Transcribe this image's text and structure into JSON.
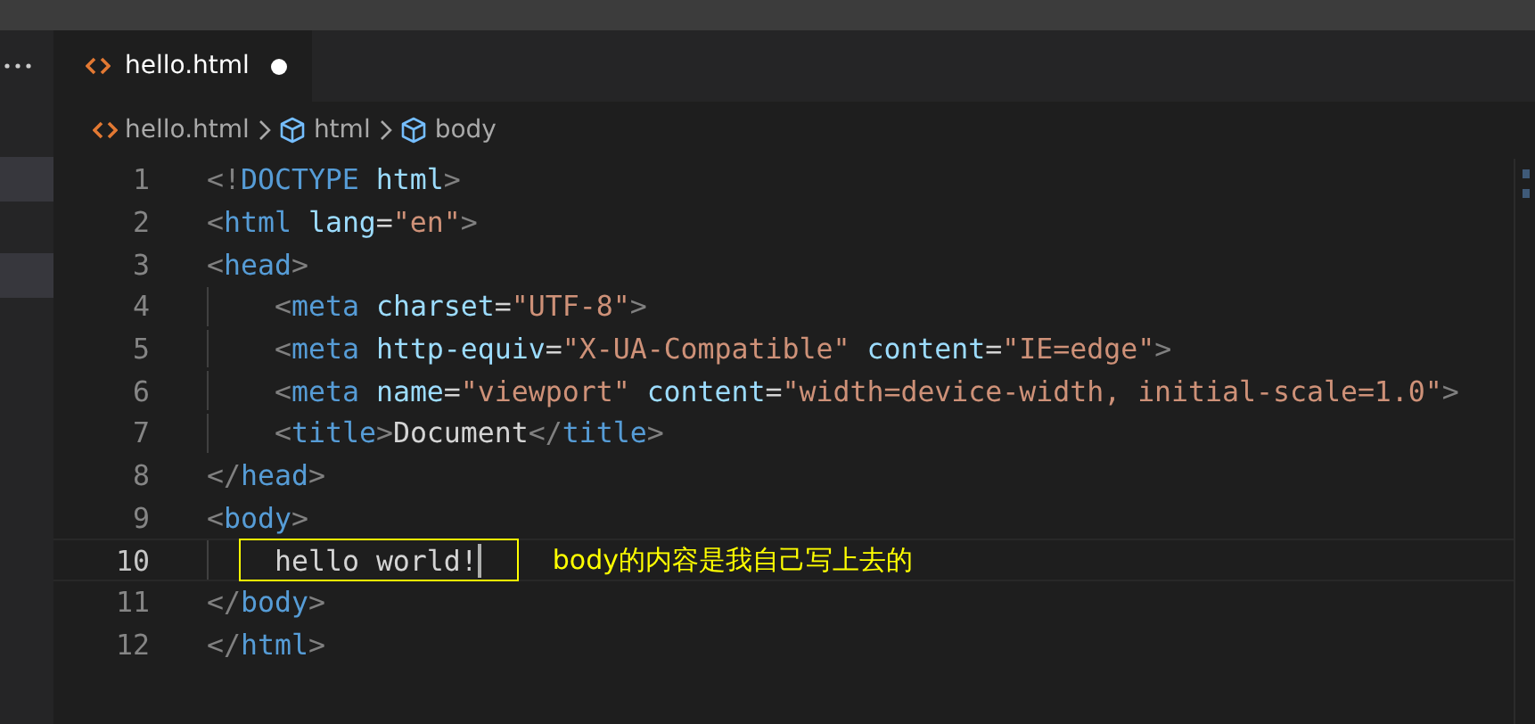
{
  "tab": {
    "label": "hello.html",
    "modified": true,
    "selected": true
  },
  "breadcrumb": [
    {
      "kind": "file",
      "label": "hello.html"
    },
    {
      "kind": "element",
      "label": "html"
    },
    {
      "kind": "element",
      "label": "body"
    }
  ],
  "code_lines": [
    {
      "number": "1",
      "active": false,
      "indented": false,
      "tokens": [
        {
          "kind": "punct",
          "text": "<!"
        },
        {
          "kind": "tag",
          "text": "DOCTYPE"
        },
        {
          "kind": "attr",
          "text": " html"
        },
        {
          "kind": "punct",
          "text": ">"
        }
      ]
    },
    {
      "number": "2",
      "active": false,
      "indented": false,
      "tokens": [
        {
          "kind": "punct",
          "text": "<"
        },
        {
          "kind": "tag",
          "text": "html"
        },
        {
          "kind": "attr",
          "text": " lang"
        },
        {
          "kind": "plain",
          "text": "="
        },
        {
          "kind": "value",
          "text": "\"en\""
        },
        {
          "kind": "punct",
          "text": ">"
        }
      ]
    },
    {
      "number": "3",
      "active": false,
      "indented": false,
      "tokens": [
        {
          "kind": "punct",
          "text": "<"
        },
        {
          "kind": "tag",
          "text": "head"
        },
        {
          "kind": "punct",
          "text": ">"
        }
      ]
    },
    {
      "number": "4",
      "active": false,
      "indented": true,
      "tokens": [
        {
          "kind": "punct",
          "text": "<"
        },
        {
          "kind": "tag",
          "text": "meta"
        },
        {
          "kind": "attr",
          "text": " charset"
        },
        {
          "kind": "plain",
          "text": "="
        },
        {
          "kind": "value",
          "text": "\"UTF-8\""
        },
        {
          "kind": "punct",
          "text": ">"
        }
      ]
    },
    {
      "number": "5",
      "active": false,
      "indented": true,
      "tokens": [
        {
          "kind": "punct",
          "text": "<"
        },
        {
          "kind": "tag",
          "text": "meta"
        },
        {
          "kind": "attr",
          "text": " http-equiv"
        },
        {
          "kind": "plain",
          "text": "="
        },
        {
          "kind": "value",
          "text": "\"X-UA-Compatible\""
        },
        {
          "kind": "attr",
          "text": " content"
        },
        {
          "kind": "plain",
          "text": "="
        },
        {
          "kind": "value",
          "text": "\"IE=edge\""
        },
        {
          "kind": "punct",
          "text": ">"
        }
      ]
    },
    {
      "number": "6",
      "active": false,
      "indented": true,
      "tokens": [
        {
          "kind": "punct",
          "text": "<"
        },
        {
          "kind": "tag",
          "text": "meta"
        },
        {
          "kind": "attr",
          "text": " name"
        },
        {
          "kind": "plain",
          "text": "="
        },
        {
          "kind": "value",
          "text": "\"viewport\""
        },
        {
          "kind": "attr",
          "text": " content"
        },
        {
          "kind": "plain",
          "text": "="
        },
        {
          "kind": "value",
          "text": "\"width=device-width, initial-scale=1.0\""
        },
        {
          "kind": "punct",
          "text": ">"
        }
      ]
    },
    {
      "number": "7",
      "active": false,
      "indented": true,
      "tokens": [
        {
          "kind": "punct",
          "text": "<"
        },
        {
          "kind": "tag",
          "text": "title"
        },
        {
          "kind": "punct",
          "text": ">"
        },
        {
          "kind": "plain",
          "text": "Document"
        },
        {
          "kind": "punct",
          "text": "</"
        },
        {
          "kind": "tag",
          "text": "title"
        },
        {
          "kind": "punct",
          "text": ">"
        }
      ]
    },
    {
      "number": "8",
      "active": false,
      "indented": false,
      "tokens": [
        {
          "kind": "punct",
          "text": "</"
        },
        {
          "kind": "tag",
          "text": "head"
        },
        {
          "kind": "punct",
          "text": ">"
        }
      ]
    },
    {
      "number": "9",
      "active": false,
      "indented": false,
      "tokens": [
        {
          "kind": "punct",
          "text": "<"
        },
        {
          "kind": "tag",
          "text": "body"
        },
        {
          "kind": "punct",
          "text": ">"
        }
      ]
    },
    {
      "number": "10",
      "active": true,
      "indented": true,
      "note": "body的内容是我自己写上去的",
      "tokens": [
        {
          "kind": "plain",
          "text": "hello world!"
        }
      ]
    },
    {
      "number": "11",
      "active": false,
      "indented": false,
      "tokens": [
        {
          "kind": "punct",
          "text": "</"
        },
        {
          "kind": "tag",
          "text": "body"
        },
        {
          "kind": "punct",
          "text": ">"
        }
      ]
    },
    {
      "number": "12",
      "active": false,
      "indented": false,
      "tokens": [
        {
          "kind": "punct",
          "text": "</"
        },
        {
          "kind": "tag",
          "text": "html"
        },
        {
          "kind": "punct",
          "text": ">"
        }
      ]
    }
  ]
}
